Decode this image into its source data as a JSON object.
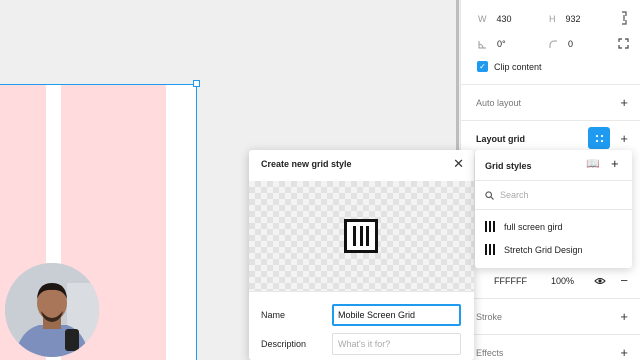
{
  "properties": {
    "w_label": "W",
    "w_value": "430",
    "h_label": "H",
    "h_value": "932",
    "rotation_value": "0°",
    "radius_value": "0",
    "clip_content_label": "Clip content",
    "clip_content_checked": true
  },
  "sections": {
    "auto_layout": "Auto layout",
    "layout_grid": "Layout grid",
    "stroke": "Stroke",
    "effects": "Effects"
  },
  "grid_row": {
    "color_hex": "FFFFFF",
    "opacity": "100%"
  },
  "dialog": {
    "title": "Create new grid style",
    "name_label": "Name",
    "name_value": "Mobile Screen Grid",
    "description_label": "Description",
    "description_placeholder": "What's it for?"
  },
  "grid_styles": {
    "title": "Grid styles",
    "search_placeholder": "Search",
    "items": [
      "full screen gird",
      "Stretch Grid Design"
    ]
  },
  "colors": {
    "accent": "#1e9bf0",
    "grid_column": "#ffdbdd"
  },
  "icons": {
    "rotation": "rotation-icon",
    "corner_radius": "corner-radius-icon",
    "constrain": "constrain-proportions-icon",
    "independent_corners": "independent-corners-icon",
    "grid": "grid-icon",
    "library": "book-icon",
    "search": "search-icon",
    "close": "close-icon",
    "visibility": "eye-icon"
  }
}
